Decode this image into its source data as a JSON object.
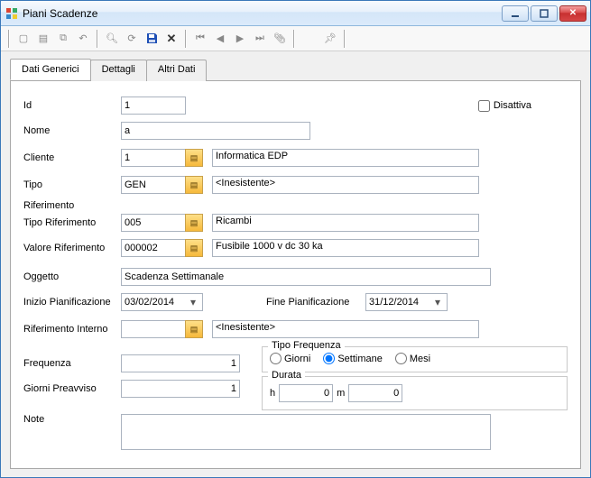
{
  "window": {
    "title": "Piani Scadenze"
  },
  "tabs": {
    "generici": "Dati Generici",
    "dettagli": "Dettagli",
    "altri": "Altri Dati"
  },
  "labels": {
    "id": "Id",
    "nome": "Nome",
    "cliente": "Cliente",
    "tipo": "Tipo",
    "riferimento": "Riferimento",
    "tipoRif": "Tipo Riferimento",
    "valoreRif": "Valore Riferimento",
    "oggetto": "Oggetto",
    "inizio": "Inizio Pianificazione",
    "fine": "Fine Pianificazione",
    "rifInterno": "Riferimento Interno",
    "frequenza": "Frequenza",
    "giorniPreavviso": "Giorni Preavviso",
    "note": "Note",
    "tipoFrequenza": "Tipo Frequenza",
    "durata": "Durata",
    "h": "h",
    "m": "m",
    "disattiva": "Disattiva",
    "radio": {
      "giorni": "Giorni",
      "settimane": "Settimane",
      "mesi": "Mesi"
    }
  },
  "values": {
    "id": "1",
    "nome": "a",
    "cliente": "1",
    "clienteDesc": "Informatica EDP",
    "tipo": "GEN",
    "tipoDesc": "<Inesistente>",
    "tipoRif": "005",
    "tipoRifDesc": "Ricambi",
    "valoreRif": "000002",
    "valoreRifDesc": "Fusibile 1000 v dc 30 ka",
    "oggetto": "Scadenza Settimanale",
    "inizio": "03/02/2014",
    "fine": "31/12/2014",
    "rifInterno": "",
    "rifInternoDesc": "<Inesistente>",
    "frequenza": "1",
    "giorniPreavviso": "1",
    "durataH": "0",
    "durataM": "0",
    "note": "",
    "tipoFrequenzaSelected": "settimane",
    "disattiva": false
  }
}
